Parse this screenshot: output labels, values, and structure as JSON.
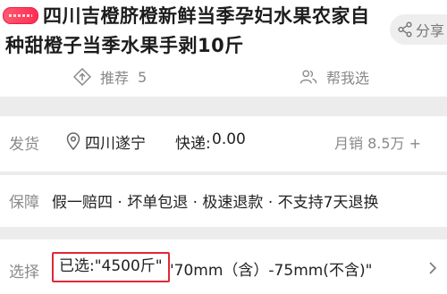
{
  "product": {
    "title_line1": "四川吉橙脐橙新鲜当季孕妇水果农家自",
    "title_line2": "种甜橙子当季水果手剥10斤"
  },
  "share": {
    "label": "分享"
  },
  "stats": {
    "recommend_label": "推荐",
    "recommend_count": "5",
    "help_label": "帮我选"
  },
  "shipping": {
    "label": "发货",
    "location": "四川遂宁",
    "fee_label": "快递:",
    "fee_value": "0.00",
    "monthly_sales": "月销 8.5万 +"
  },
  "guarantee": {
    "label": "保障",
    "text": "假一赔四 · 坏单包退 · 极速退款 · 不支持7天退换"
  },
  "selection": {
    "label": "选择",
    "selected_text": "已选:\"4500斤\"",
    "spec_text": "'70mm（含）-75mm(不含)\""
  },
  "colors": {
    "highlight_border": "#e32636",
    "tag_pink": "#ff2d55"
  }
}
